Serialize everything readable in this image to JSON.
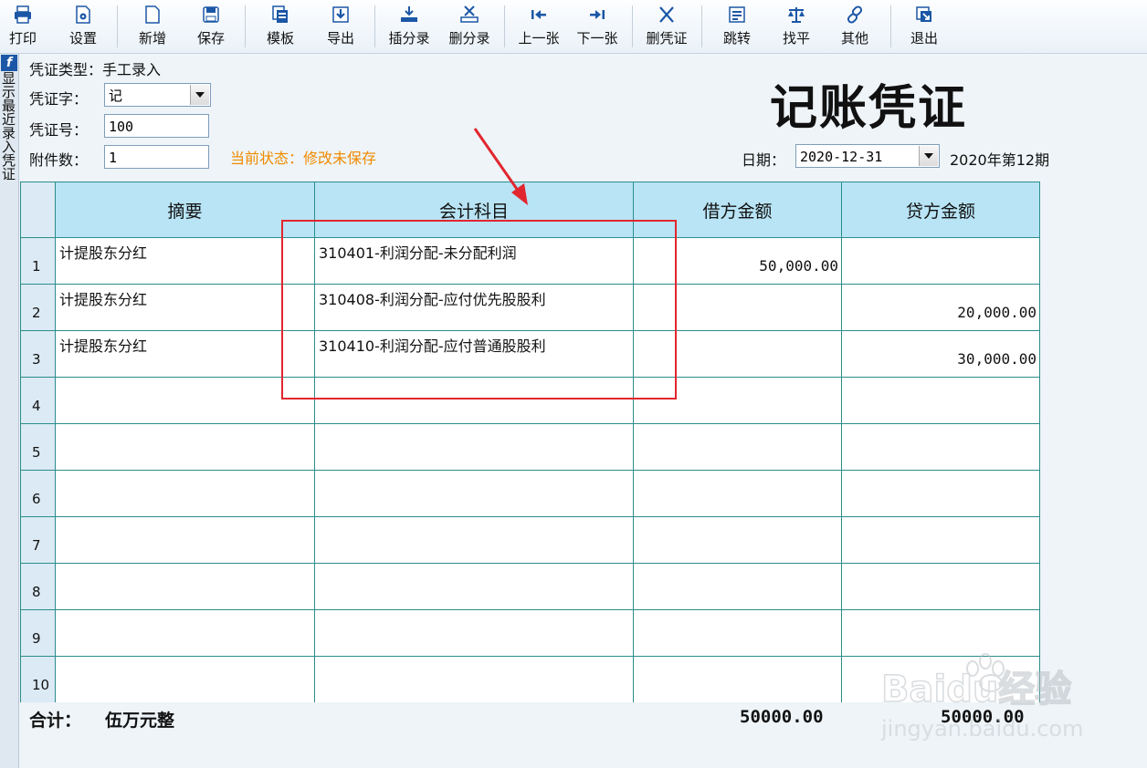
{
  "toolbar": {
    "buttons": [
      {
        "label": "打印",
        "icon": "printer-icon"
      },
      {
        "label": "设置",
        "icon": "settings-icon"
      },
      {
        "label": "新增",
        "icon": "new-doc-icon"
      },
      {
        "label": "保存",
        "icon": "save-icon"
      },
      {
        "label": "模板",
        "icon": "template-icon"
      },
      {
        "label": "导出",
        "icon": "export-icon"
      },
      {
        "label": "插分录",
        "icon": "insert-row-icon"
      },
      {
        "label": "删分录",
        "icon": "delete-row-icon"
      },
      {
        "label": "上一张",
        "icon": "prev-icon"
      },
      {
        "label": "下一张",
        "icon": "next-icon"
      },
      {
        "label": "删凭证",
        "icon": "close-x-icon"
      },
      {
        "label": "跳转",
        "icon": "jump-icon"
      },
      {
        "label": "找平",
        "icon": "balance-icon"
      },
      {
        "label": "其他",
        "icon": "link-icon"
      },
      {
        "label": "退出",
        "icon": "exit-icon"
      }
    ]
  },
  "sidebar": {
    "badge": "f",
    "text": "显示最近录入凭证"
  },
  "form": {
    "voucher_type_label": "凭证类型：手工录入",
    "voucher_word_label": "凭证字：",
    "voucher_word_value": "记",
    "voucher_no_label": "凭证号：",
    "voucher_no_value": "100",
    "attachments_label": "附件数：",
    "attachments_value": "1",
    "status_text": "当前状态：修改未保存",
    "date_label": "日期：",
    "date_value": "2020-12-31",
    "period_text": "2020年第12期"
  },
  "title": "记账凭证",
  "table": {
    "headers": [
      "摘要",
      "会计科目",
      "借方金额",
      "贷方金额"
    ],
    "rows": [
      {
        "no": "1",
        "summary": "计提股东分红",
        "account": "310401-利润分配-未分配利润",
        "debit": "50,000.00",
        "credit": ""
      },
      {
        "no": "2",
        "summary": "计提股东分红",
        "account": "310408-利润分配-应付优先股股利",
        "debit": "",
        "credit": "20,000.00"
      },
      {
        "no": "3",
        "summary": "计提股东分红",
        "account": "310410-利润分配-应付普通股股利",
        "debit": "",
        "credit": "30,000.00"
      },
      {
        "no": "4",
        "summary": "",
        "account": "",
        "debit": "",
        "credit": ""
      },
      {
        "no": "5",
        "summary": "",
        "account": "",
        "debit": "",
        "credit": ""
      },
      {
        "no": "6",
        "summary": "",
        "account": "",
        "debit": "",
        "credit": ""
      },
      {
        "no": "7",
        "summary": "",
        "account": "",
        "debit": "",
        "credit": ""
      },
      {
        "no": "8",
        "summary": "",
        "account": "",
        "debit": "",
        "credit": ""
      },
      {
        "no": "9",
        "summary": "",
        "account": "",
        "debit": "",
        "credit": ""
      },
      {
        "no": "10",
        "summary": "",
        "account": "",
        "debit": "",
        "credit": ""
      }
    ]
  },
  "totals": {
    "label": "合计：",
    "amount_words": "伍万元整",
    "debit_total": "50000.00",
    "credit_total": "50000.00"
  },
  "watermark": {
    "brand": "Baidu经验",
    "url": "jingyan.baidu.com"
  },
  "colors": {
    "annotation_red": "#e2262f",
    "header_bg": "#b8e4f5",
    "grid_line": "#2b8d8b",
    "status_orange": "#f08a00"
  }
}
